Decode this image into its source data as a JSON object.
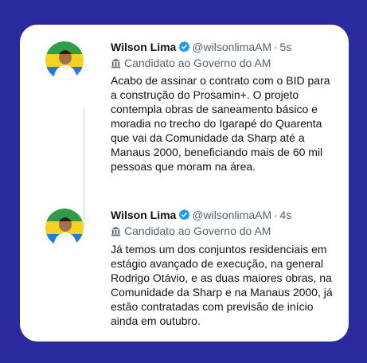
{
  "tweets": [
    {
      "name": "Wilson Lima",
      "handle": "@wilsonlimaAM",
      "separator": "·",
      "time": "5s",
      "label": "Candidato ao Governo do AM",
      "lines": [
        "Acabo de assinar o contrato com o BID para",
        "a construção do Prosamin+. O projeto",
        "contempla obras de saneamento básico e",
        "moradia no trecho do Igarapé do Quarenta",
        "que vai da Comunidade da Sharp até a",
        "Manaus 2000, beneficiando mais de 60 mil",
        "pessoas que moram na área."
      ]
    },
    {
      "name": "Wilson Lima",
      "handle": "@wilsonlimaAM",
      "separator": "·",
      "time": "4s",
      "label": "Candidato ao Governo do AM",
      "lines": [
        "Já temos um dos conjuntos residenciais em",
        "estágio avançado de execução, na general",
        "Rodrigo Otávio, e as duas maiores obras, na",
        "Comunidade da Sharp e na Manaus 2000, já",
        "estão contratadas com previsão de início",
        "ainda em outubro."
      ]
    }
  ],
  "colors": {
    "background": "#2b2a9c",
    "card": "#ffffff",
    "verified": "#1d9bf0",
    "secondary_text": "#536471"
  },
  "icons": {
    "verified": "verified-badge-icon",
    "label": "government-building-icon"
  }
}
